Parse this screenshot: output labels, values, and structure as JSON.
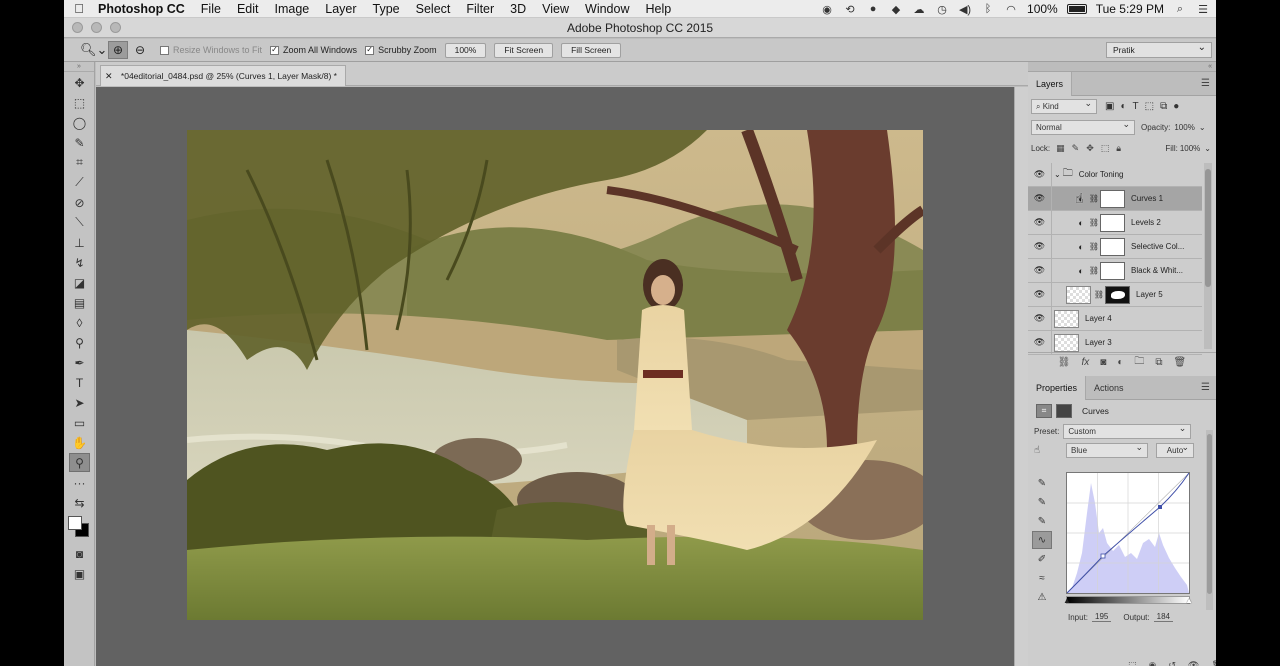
{
  "menubar": {
    "app": "Photoshop CC",
    "items": [
      "File",
      "Edit",
      "Image",
      "Layer",
      "Type",
      "Select",
      "Filter",
      "3D",
      "View",
      "Window",
      "Help"
    ],
    "battery": "100%",
    "clock": "Tue 5:29 PM"
  },
  "window": {
    "title": "Adobe Photoshop CC 2015"
  },
  "options": {
    "resize_windows": "Resize Windows to Fit",
    "zoom_all": "Zoom All Windows",
    "scrubby_zoom": "Scrubby Zoom",
    "zoom_100": "100%",
    "fit_screen": "Fit Screen",
    "fill_screen": "Fill Screen",
    "workspace": "Pratik"
  },
  "document": {
    "tab_title": "*04editorial_0484.psd @ 25% (Curves 1, Layer Mask/8) *"
  },
  "layers_panel": {
    "tab": "Layers",
    "filter_kind": "Kind",
    "blend_mode": "Normal",
    "opacity_label": "Opacity:",
    "opacity": "100%",
    "lock_label": "Lock:",
    "fill_label": "Fill:",
    "fill": "100%",
    "group": "Color Toning",
    "layers": [
      {
        "name": "Curves 1"
      },
      {
        "name": "Levels 2"
      },
      {
        "name": "Selective Col..."
      },
      {
        "name": "Black & Whit..."
      },
      {
        "name": "Layer 5"
      },
      {
        "name": "Layer 4"
      },
      {
        "name": "Layer 3"
      }
    ]
  },
  "properties_panel": {
    "tabs": [
      "Properties",
      "Actions"
    ],
    "title": "Curves",
    "preset_label": "Preset:",
    "preset": "Custom",
    "channel": "Blue",
    "auto": "Auto",
    "input_label": "Input:",
    "input": "195",
    "output_label": "Output:",
    "output": "184"
  }
}
